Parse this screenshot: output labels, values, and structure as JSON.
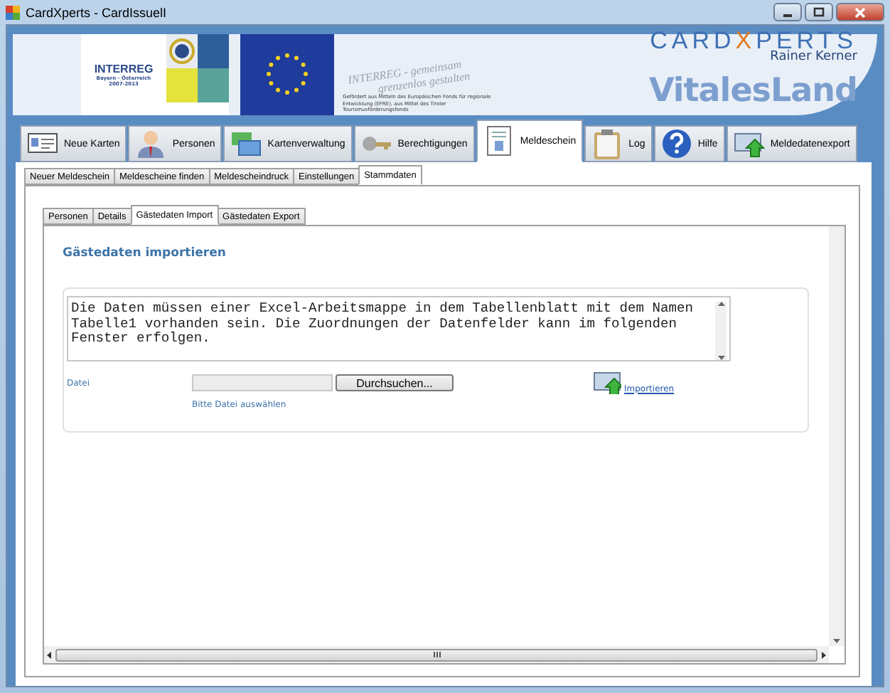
{
  "window": {
    "title": "CardXperts - CardIssuelI"
  },
  "banner": {
    "program_logo": {
      "name": "INTERREG",
      "region": "Bayern - Österreich",
      "years": "2007-2013"
    },
    "slogan": [
      "INTERREG - gemeinsam",
      "grenzenlos gestalten"
    ],
    "funding_note": "Gefördert aus Mitteln des Europäischen Fonds für regionale Entwicklung (EFRE), aus Mittel des Tiroler Tourismusförderungsfonds",
    "brand": {
      "left": "CARD",
      "mark": "X",
      "right": "PERTS",
      "owner": "Rainer Kerner"
    },
    "product": "VitalesLand"
  },
  "main_tabs": [
    {
      "label": "Neue Karten",
      "selected": false
    },
    {
      "label": "Personen",
      "selected": false
    },
    {
      "label": "Kartenverwaltung",
      "selected": false
    },
    {
      "label": "Berechtigungen",
      "selected": false
    },
    {
      "label": "Meldeschein",
      "selected": true
    },
    {
      "label": "Log",
      "selected": false
    },
    {
      "label": "Hilfe",
      "selected": false
    },
    {
      "label": "Meldedatenexport",
      "selected": false
    }
  ],
  "sub_tabs": [
    {
      "label": "Neuer Meldeschein",
      "selected": false
    },
    {
      "label": "Meldescheine finden",
      "selected": false
    },
    {
      "label": "Meldescheindruck",
      "selected": false
    },
    {
      "label": "Einstellungen",
      "selected": false
    },
    {
      "label": "Stammdaten",
      "selected": true
    }
  ],
  "inner_tabs": [
    {
      "label": "Personen",
      "selected": false
    },
    {
      "label": "Details",
      "selected": false
    },
    {
      "label": "Gästedaten Import",
      "selected": true
    },
    {
      "label": "Gästedaten Export",
      "selected": false
    }
  ],
  "import_panel": {
    "heading": "Gästedaten importieren",
    "info_text": "Die Daten müssen einer Excel-Arbeitsmappe in dem Tabellenblatt mit dem Namen Tabelle1 vorhanden sein. Die Zuordnungen der Datenfelder kann im folgenden Fenster erfolgen.",
    "file_label": "Datei",
    "browse_button": "Durchsuchen...",
    "hint": "Bitte Datei auswählen",
    "import_link": "Importieren"
  }
}
